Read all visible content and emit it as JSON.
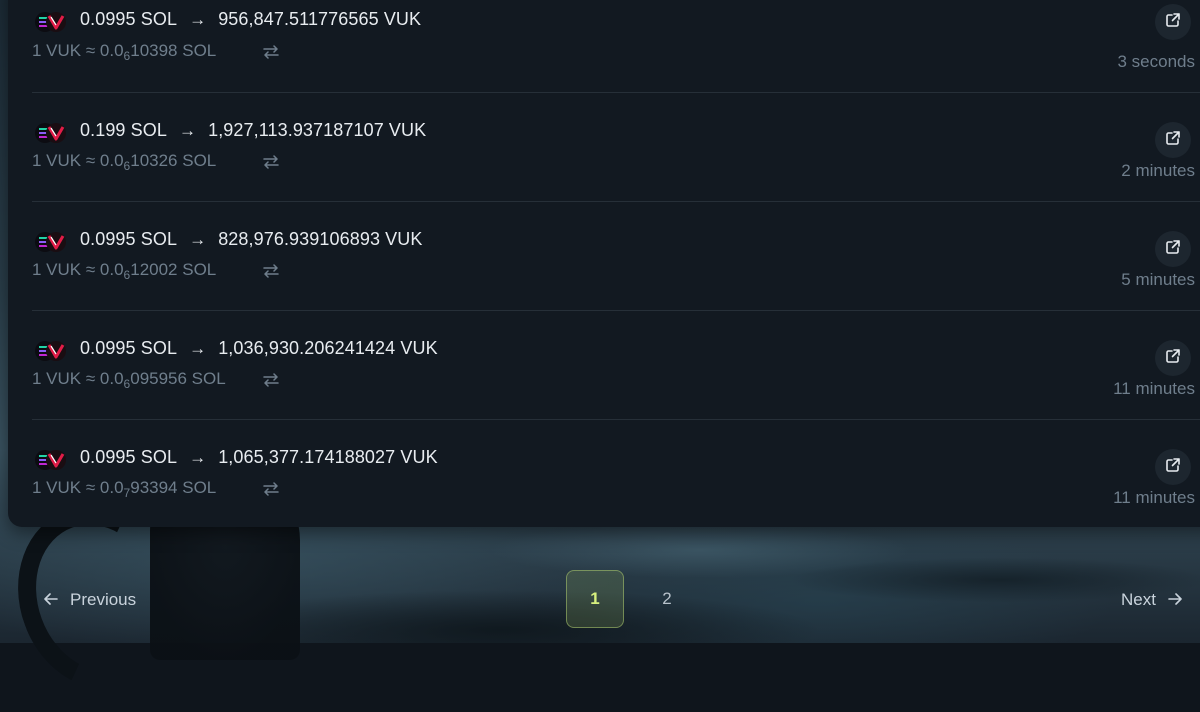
{
  "trades": [
    {
      "sol_amount": "0.0995 SOL",
      "vuk_amount": "956,847.511776565 VUK",
      "rate_prefix": "1 VUK ≈ 0.0",
      "rate_zeros": "6",
      "rate_digits": "10398 SOL",
      "time": "3 seconds"
    },
    {
      "sol_amount": "0.199 SOL",
      "vuk_amount": "1,927,113.937187107 VUK",
      "rate_prefix": "1 VUK ≈ 0.0",
      "rate_zeros": "6",
      "rate_digits": "10326 SOL",
      "time": "2 minutes"
    },
    {
      "sol_amount": "0.0995 SOL",
      "vuk_amount": "828,976.939106893 VUK",
      "rate_prefix": "1 VUK ≈ 0.0",
      "rate_zeros": "6",
      "rate_digits": "12002 SOL",
      "time": "5 minutes"
    },
    {
      "sol_amount": "0.0995 SOL",
      "vuk_amount": "1,036,930.206241424 VUK",
      "rate_prefix": "1 VUK ≈ 0.0",
      "rate_zeros": "6",
      "rate_digits": "095956 SOL",
      "time": "11 minutes"
    },
    {
      "sol_amount": "0.0995 SOL",
      "vuk_amount": "1,065,377.174188027 VUK",
      "rate_prefix": "1 VUK ≈ 0.0",
      "rate_zeros": "7",
      "rate_digits": "93394 SOL",
      "time": "11 minutes"
    }
  ],
  "pagination": {
    "previous_label": "Previous",
    "next_label": "Next",
    "pages": [
      "1",
      "2"
    ],
    "current_page": "1"
  },
  "colors": {
    "panel_bg": "#121921",
    "primary_text": "#e8ecf0",
    "muted_text": "#6f7e8c",
    "active_page": "#d7f07e"
  },
  "icons": {
    "token": "sol-vuk-pair-icon",
    "swap": "swap-arrows-icon",
    "external": "external-link-icon",
    "arrow_right": "arrow-right-icon",
    "arrow_left": "arrow-left-icon"
  }
}
